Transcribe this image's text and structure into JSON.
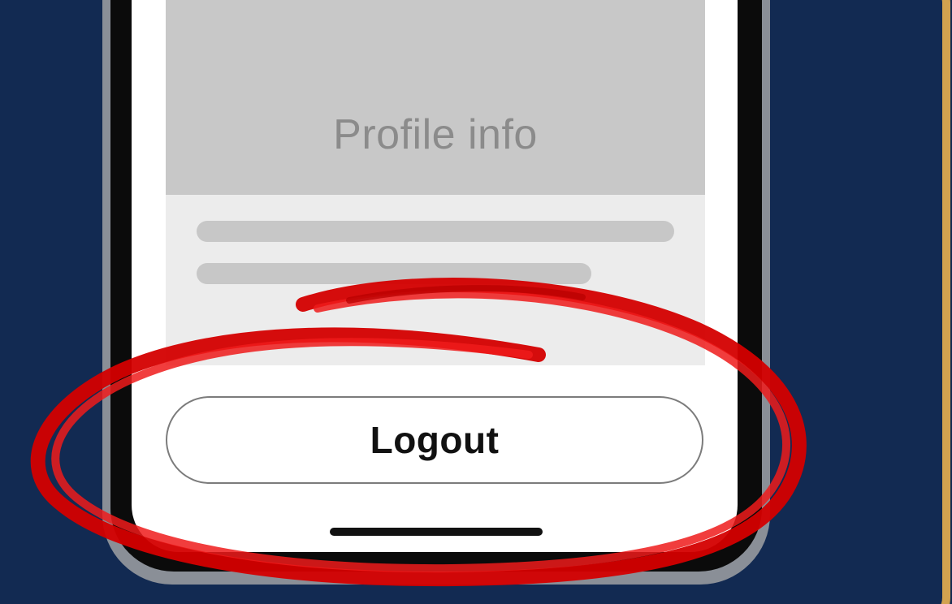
{
  "screen": {
    "profile_title": "Profile info",
    "logout_label": "Logout"
  },
  "colors": {
    "background": "#122a52",
    "frame": "#d2a24f",
    "highlight": "#d40000",
    "placeholder_gray": "#c8c8c8"
  },
  "icons": {
    "highlight": "red-circle-annotation-icon",
    "home_indicator": "home-indicator-bar"
  }
}
